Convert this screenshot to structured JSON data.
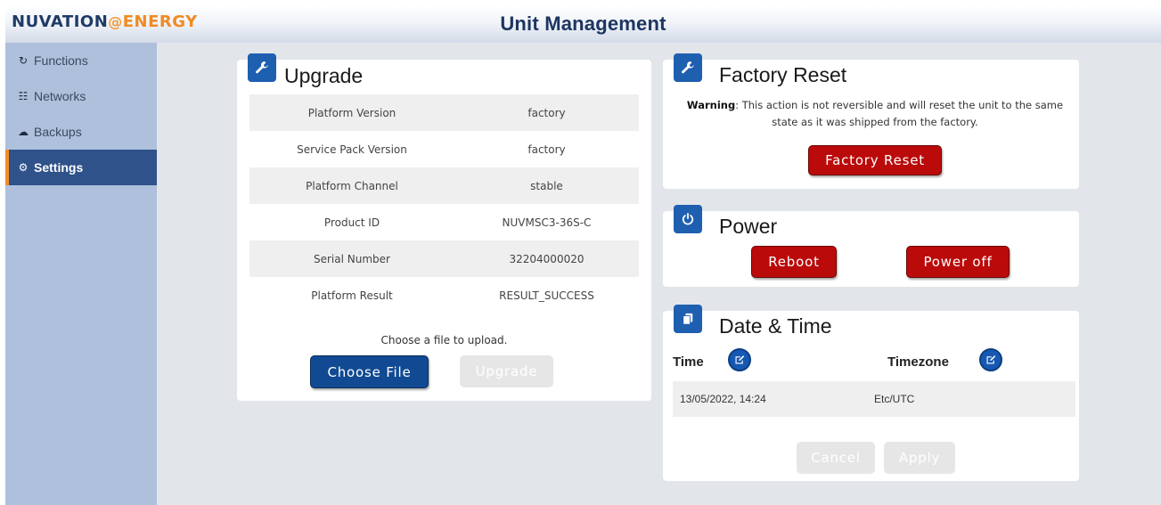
{
  "header": {
    "brand_part1": "NUVATION",
    "brand_at": "@",
    "brand_part2": "ENERGY",
    "title": "Unit Management"
  },
  "sidebar": {
    "items": [
      {
        "label": "Functions",
        "icon": "refresh-icon",
        "glyph": "↻"
      },
      {
        "label": "Networks",
        "icon": "network-icon",
        "glyph": "☷"
      },
      {
        "label": "Backups",
        "icon": "cloud-icon",
        "glyph": "☁"
      },
      {
        "label": "Settings",
        "icon": "gear-icon",
        "glyph": "⚙",
        "active": true
      }
    ]
  },
  "upgrade": {
    "title": "Upgrade",
    "icon": "wrench-icon",
    "rows": [
      {
        "key": "Platform Version",
        "value": "factory"
      },
      {
        "key": "Service Pack Version",
        "value": "factory"
      },
      {
        "key": "Platform Channel",
        "value": "stable"
      },
      {
        "key": "Product ID",
        "value": "NUVMSC3-36S-C"
      },
      {
        "key": "Serial Number",
        "value": "32204000020"
      },
      {
        "key": "Platform Result",
        "value": "RESULT_SUCCESS"
      }
    ],
    "upload_label": "Choose a file to upload.",
    "choose_file_label": "Choose File",
    "upgrade_label": "Upgrade"
  },
  "factory_reset": {
    "title": "Factory Reset",
    "icon": "wrench-icon",
    "warning_bold": "Warning",
    "warning_text": ": This action is not reversible and will reset the unit to the same state as it was shipped from the factory.",
    "button_label": "Factory Reset"
  },
  "power": {
    "title": "Power",
    "icon": "power-icon",
    "reboot_label": "Reboot",
    "poweroff_label": "Power off"
  },
  "datetime": {
    "title": "Date & Time",
    "icon": "copy-icon",
    "time_label": "Time",
    "timezone_label": "Timezone",
    "time_value": "13/05/2022, 14:24",
    "timezone_value": "Etc/UTC",
    "cancel_label": "Cancel",
    "apply_label": "Apply"
  },
  "colors": {
    "accent": "#f28c28",
    "primary": "#114a93",
    "danger": "#bb0a0a",
    "sidebar_active": "#2e5289"
  }
}
